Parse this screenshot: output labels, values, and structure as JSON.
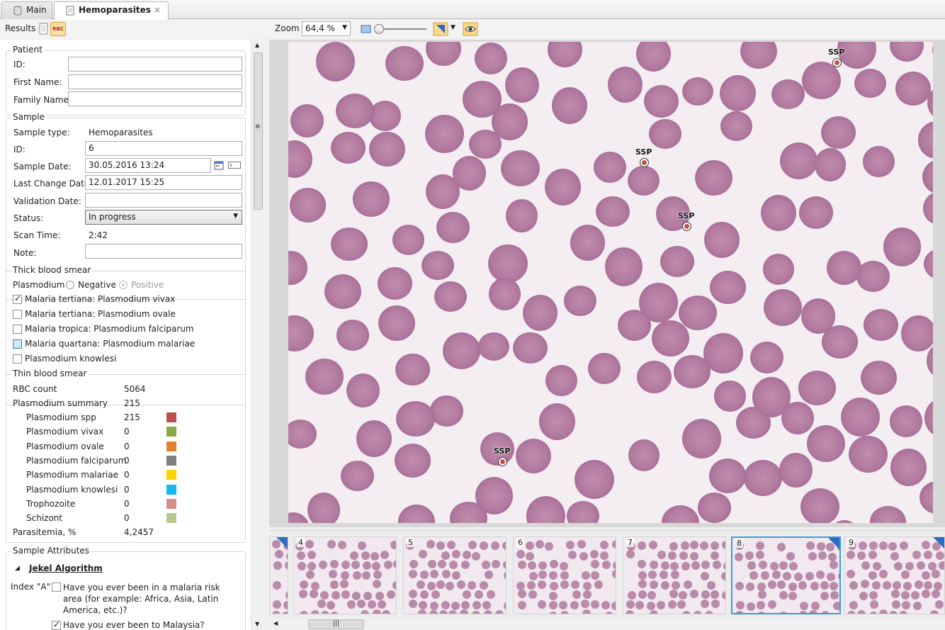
{
  "tabs": [
    {
      "label": "Main",
      "icon": "database-icon"
    },
    {
      "label": "Hemoparasites",
      "icon": "document-icon",
      "close": "×"
    }
  ],
  "toolbar": {
    "results_label": "Results",
    "rbc_label": "RBC",
    "zoom_label": "Zoom",
    "zoom_value": "64,4 %"
  },
  "patient": {
    "title": "Patient",
    "id_label": "ID:",
    "first_name_label": "First Name:",
    "family_name_label": "Family Name:",
    "id_value": "",
    "first_name_value": "",
    "family_name_value": ""
  },
  "sample": {
    "title": "Sample",
    "type_label": "Sample type:",
    "type_value": "Hemoparasites",
    "id_label": "ID:",
    "id_value": "6",
    "date_label": "Sample Date:",
    "date_value": "30.05.2016 13:24",
    "last_change_label": "Last Change Date:",
    "last_change_value": "12.01.2017 15:25",
    "validation_label": "Validation Date:",
    "validation_value": "",
    "status_label": "Status:",
    "status_value": "In progress",
    "scan_time_label": "Scan Time:",
    "scan_time_value": "2:42",
    "note_label": "Note:",
    "note_value": ""
  },
  "thick": {
    "title": "Thick blood smear",
    "plasmodium_label": "Plasmodium",
    "negative_label": "Negative",
    "positive_label": "Positive",
    "items": [
      {
        "label": "Malaria tertiana: Plasmodium vivax",
        "checked": true
      },
      {
        "label": "Malaria tertiana: Plasmodium ovale",
        "checked": false
      },
      {
        "label": "Malaria tropica: Plasmodium falciparum",
        "checked": false
      },
      {
        "label": "Malaria quartana: Plasmodium malariae",
        "checked": false
      },
      {
        "label": "Plasmodium knowlesi",
        "checked": false
      }
    ]
  },
  "thin": {
    "title": "Thin blood smear",
    "rbc_label": "RBC count",
    "rbc_value": "5064",
    "summary_label": "Plasmodium summary",
    "summary_value": "215",
    "rows": [
      {
        "label": "Plasmodium spp",
        "value": "215",
        "color": "#c0504d"
      },
      {
        "label": "Plasmodium vivax",
        "value": "0",
        "color": "#8aa745"
      },
      {
        "label": "Plasmodium ovale",
        "value": "0",
        "color": "#e0832e"
      },
      {
        "label": "Plasmodium falciparum",
        "value": "0",
        "color": "#7f7f7f"
      },
      {
        "label": "Plasmodium malariae",
        "value": "0",
        "color": "#ffd500"
      },
      {
        "label": "Plasmodium knowlesi",
        "value": "0",
        "color": "#14b8f0"
      },
      {
        "label": "Trophozoite",
        "value": "0",
        "color": "#db8a8a"
      },
      {
        "label": "Schizont",
        "value": "0",
        "color": "#b5c98a"
      }
    ],
    "parasitemia_label": "Parasitemia, %",
    "parasitemia_value": "4,2457"
  },
  "attributes": {
    "title": "Sample Attributes",
    "algorithm": "Jekel Algorithm",
    "index_label": "Index \"A\"",
    "q1": "Have you ever been in a malaria risk area (for example: Africa, Asia, Latin America, etc.)?",
    "q2": "Have you ever been to Malaysia?"
  },
  "markers": [
    {
      "label": "SSP"
    },
    {
      "label": "SSP"
    },
    {
      "label": "SSP"
    },
    {
      "label": "SSP"
    }
  ],
  "thumbnails": [
    {
      "label": "4"
    },
    {
      "label": "5"
    },
    {
      "label": "6"
    },
    {
      "label": "7"
    },
    {
      "label": "8"
    },
    {
      "label": "9"
    }
  ],
  "colors": {
    "accent": "#3c9ad8",
    "marker": "#c0504d"
  }
}
